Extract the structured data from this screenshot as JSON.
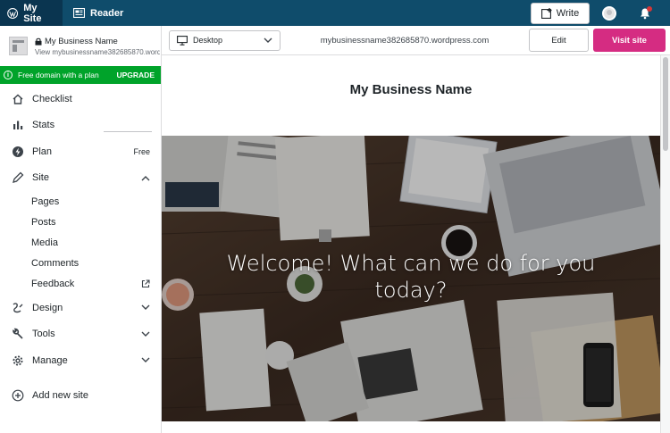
{
  "masterbar": {
    "my_site": "My Site",
    "reader": "Reader",
    "write": "Write"
  },
  "sidebar": {
    "site_name": "My Business Name",
    "site_url": "View mybusinessname382685870.wordpress.com",
    "promo": {
      "text": "Free domain with a plan",
      "action": "UPGRADE"
    },
    "items": [
      {
        "label": "Checklist",
        "icon": "home-icon"
      },
      {
        "label": "Stats",
        "icon": "bar-chart-icon"
      },
      {
        "label": "Plan",
        "icon": "plan-icon",
        "badge": "Free"
      },
      {
        "label": "Site",
        "icon": "pencil-icon",
        "expanded": true
      },
      {
        "label": "Design",
        "icon": "design-icon"
      },
      {
        "label": "Tools",
        "icon": "wrench-icon"
      },
      {
        "label": "Manage",
        "icon": "gear-icon"
      },
      {
        "label": "Add new site",
        "icon": "plus-circle-icon"
      }
    ],
    "site_subitems": [
      {
        "label": "Pages"
      },
      {
        "label": "Posts"
      },
      {
        "label": "Media"
      },
      {
        "label": "Comments"
      },
      {
        "label": "Feedback",
        "external": true
      }
    ]
  },
  "preview": {
    "device": "Desktop",
    "url": "mybusinessname382685870.wordpress.com",
    "edit_label": "Edit",
    "visit_label": "Visit site",
    "site_title": "My Business Name",
    "hero_text": "Welcome! What can we do for you today?"
  },
  "colors": {
    "masterbar": "#0f4c6b",
    "masterbar_active": "#0a3550",
    "upgrade_green": "#00a32a",
    "visit_pink": "#d52c82"
  }
}
